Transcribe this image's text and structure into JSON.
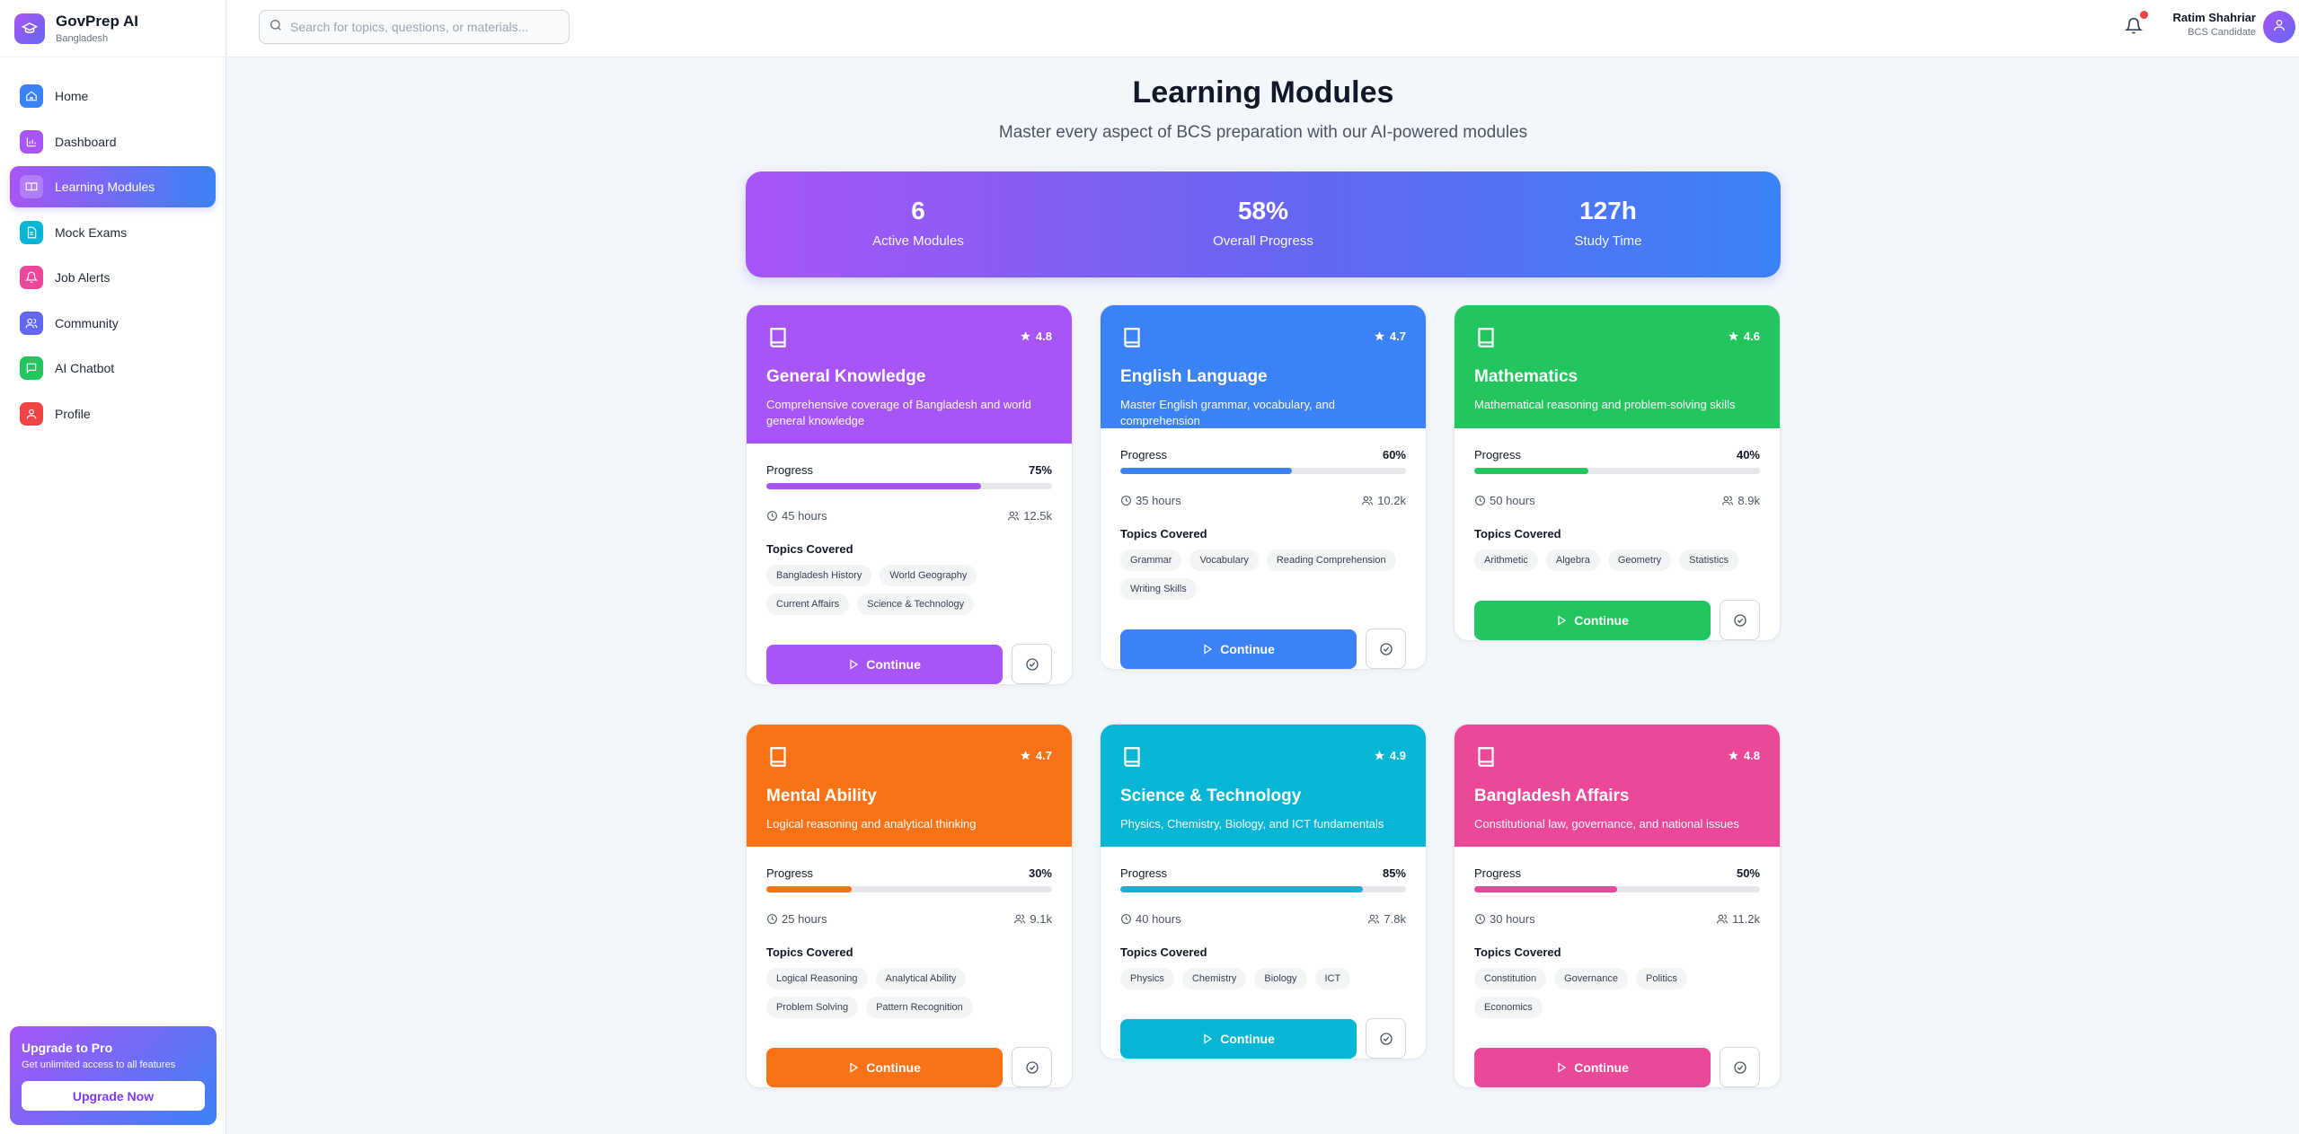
{
  "app": {
    "name": "GovPrep AI",
    "country": "Bangladesh"
  },
  "search": {
    "placeholder": "Search for topics, questions, or materials..."
  },
  "user": {
    "name": "Ratim Shahriar",
    "role": "BCS Candidate"
  },
  "sidebar": {
    "items": [
      {
        "label": "Home",
        "icon": "home-icon",
        "color": "#3b82f6"
      },
      {
        "label": "Dashboard",
        "icon": "chart-icon",
        "color": "#a855f7"
      },
      {
        "label": "Learning Modules",
        "icon": "book-open-icon",
        "color": "#8b5cf6"
      },
      {
        "label": "Mock Exams",
        "icon": "document-icon",
        "color": "#06b6d4"
      },
      {
        "label": "Job Alerts",
        "icon": "bell-icon",
        "color": "#ec4899"
      },
      {
        "label": "Community",
        "icon": "users-icon",
        "color": "#6366f1"
      },
      {
        "label": "AI Chatbot",
        "icon": "chat-icon",
        "color": "#22c55e"
      },
      {
        "label": "Profile",
        "icon": "user-icon",
        "color": "#ef4444"
      }
    ],
    "upgrade": {
      "title": "Upgrade to Pro",
      "desc": "Get unlimited access to all features",
      "button": "Upgrade Now"
    }
  },
  "main": {
    "title": "Learning Modules",
    "subtitle": "Master every aspect of BCS preparation with our AI-powered modules",
    "stats": [
      {
        "value": "6",
        "label": "Active Modules"
      },
      {
        "value": "58%",
        "label": "Overall Progress"
      },
      {
        "value": "127h",
        "label": "Study Time"
      }
    ],
    "progress_label": "Progress",
    "topics_label": "Topics Covered",
    "continue_label": "Continue",
    "modules": [
      {
        "title": "General Knowledge",
        "desc": "Comprehensive coverage of Bangladesh and world general knowledge",
        "rating": "4.8",
        "progress": 75,
        "progress_text": "75%",
        "hours": "45 hours",
        "learners": "12.5k",
        "topics": [
          "Bangladesh History",
          "World Geography",
          "Current Affairs",
          "Science & Technology"
        ],
        "color": "#a855f7"
      },
      {
        "title": "English Language",
        "desc": "Master English grammar, vocabulary, and comprehension",
        "rating": "4.7",
        "progress": 60,
        "progress_text": "60%",
        "hours": "35 hours",
        "learners": "10.2k",
        "topics": [
          "Grammar",
          "Vocabulary",
          "Reading Comprehension",
          "Writing Skills"
        ],
        "color": "#3b82f6"
      },
      {
        "title": "Mathematics",
        "desc": "Mathematical reasoning and problem-solving skills",
        "rating": "4.6",
        "progress": 40,
        "progress_text": "40%",
        "hours": "50 hours",
        "learners": "8.9k",
        "topics": [
          "Arithmetic",
          "Algebra",
          "Geometry",
          "Statistics"
        ],
        "color": "#22c55e"
      },
      {
        "title": "Mental Ability",
        "desc": "Logical reasoning and analytical thinking",
        "rating": "4.7",
        "progress": 30,
        "progress_text": "30%",
        "hours": "25 hours",
        "learners": "9.1k",
        "topics": [
          "Logical Reasoning",
          "Analytical Ability",
          "Problem Solving",
          "Pattern Recognition"
        ],
        "color": "#f97316"
      },
      {
        "title": "Science & Technology",
        "desc": "Physics, Chemistry, Biology, and ICT fundamentals",
        "rating": "4.9",
        "progress": 85,
        "progress_text": "85%",
        "hours": "40 hours",
        "learners": "7.8k",
        "topics": [
          "Physics",
          "Chemistry",
          "Biology",
          "ICT"
        ],
        "color": "#06b6d4"
      },
      {
        "title": "Bangladesh Affairs",
        "desc": "Constitutional law, governance, and national issues",
        "rating": "4.8",
        "progress": 50,
        "progress_text": "50%",
        "hours": "30 hours",
        "learners": "11.2k",
        "topics": [
          "Constitution",
          "Governance",
          "Politics",
          "Economics"
        ],
        "color": "#ec4899"
      }
    ]
  }
}
